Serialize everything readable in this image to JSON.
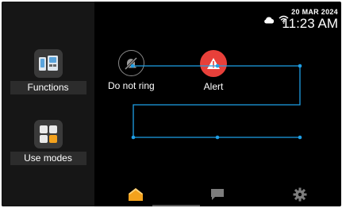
{
  "status": {
    "date": "20 MAR 2024",
    "time": "11:23 AM",
    "icons": [
      "cloud-icon",
      "wifi-icon"
    ]
  },
  "sidebar": {
    "items": [
      {
        "label": "Functions",
        "icon": "intercom-icon"
      },
      {
        "label": "Use modes",
        "icon": "grid-icon"
      }
    ]
  },
  "actions": [
    {
      "label": "Do not ring",
      "icon": "bell-off-icon"
    },
    {
      "label": "Alert",
      "icon": "alert-icon"
    }
  ],
  "tabs": [
    {
      "icon": "home-icon",
      "active": true
    },
    {
      "icon": "chat-icon",
      "active": false
    },
    {
      "icon": "gear-icon",
      "active": false
    }
  ],
  "colors": {
    "accent": "#f4a21d",
    "alert": "#e8403a",
    "overlay_line": "#1e9fe6"
  }
}
